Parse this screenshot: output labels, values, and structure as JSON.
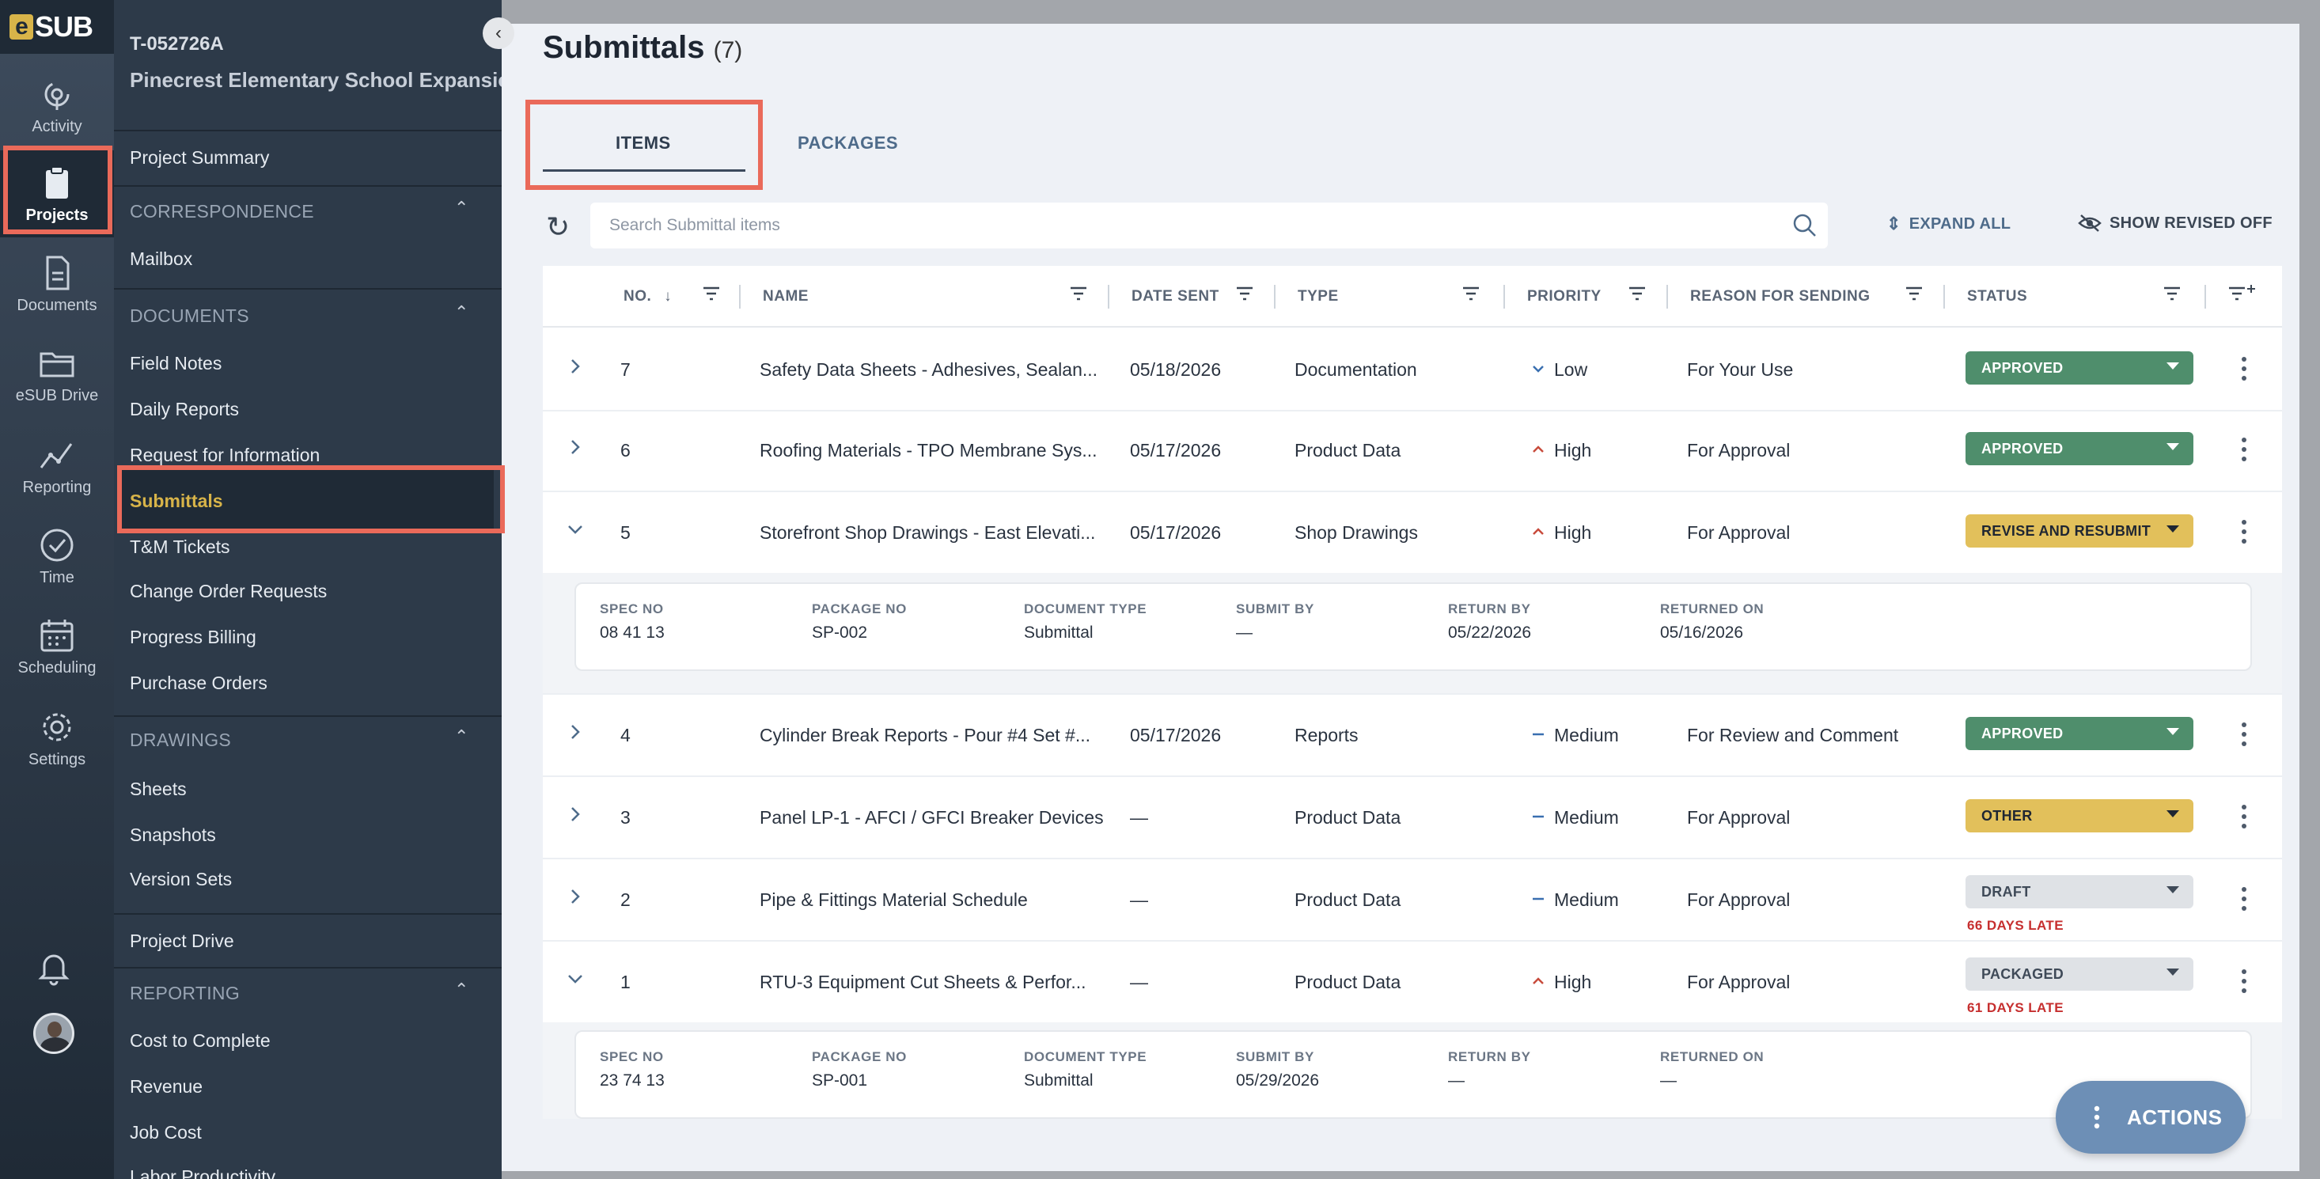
{
  "rail": {
    "logo": "SUB",
    "items": [
      {
        "label": "Activity",
        "icon": "activity-icon"
      },
      {
        "label": "Projects",
        "icon": "clipboard-icon"
      },
      {
        "label": "Documents",
        "icon": "document-icon"
      },
      {
        "label": "eSUB Drive",
        "icon": "folder-icon"
      },
      {
        "label": "Reporting",
        "icon": "chart-line-icon"
      },
      {
        "label": "Time",
        "icon": "clock-icon"
      },
      {
        "label": "Scheduling",
        "icon": "calendar-icon"
      },
      {
        "label": "Settings",
        "icon": "gear-icon"
      }
    ]
  },
  "nav": {
    "project_id": "T-052726A",
    "project_name": "Pinecrest Elementary School Expansion",
    "summary": "Project Summary",
    "correspondence": "CORRESPONDENCE",
    "mailbox": "Mailbox",
    "documents": "DOCUMENTS",
    "doc_items": [
      "Field Notes",
      "Daily Reports",
      "Request for Information",
      "Submittals",
      "T&M Tickets",
      "Change Order Requests",
      "Progress Billing",
      "Purchase Orders"
    ],
    "drawings": "DRAWINGS",
    "draw_items": [
      "Sheets",
      "Snapshots",
      "Version Sets"
    ],
    "project_drive": "Project Drive",
    "reporting": "REPORTING",
    "rep_items": [
      "Cost to Complete",
      "Revenue",
      "Job Cost",
      "Labor Productivity"
    ]
  },
  "main": {
    "title": "Submittals",
    "count": "(7)",
    "tabs": {
      "items": "ITEMS",
      "packages": "PACKAGES"
    },
    "search_placeholder": "Search Submittal items",
    "expand_all": "EXPAND ALL",
    "show_revised": "SHOW REVISED OFF",
    "actions": "ACTIONS"
  },
  "table": {
    "headers": {
      "no": "NO.",
      "name": "NAME",
      "date_sent": "DATE SENT",
      "type": "TYPE",
      "priority": "PRIORITY",
      "reason": "REASON FOR SENDING",
      "status": "STATUS"
    },
    "rows": [
      {
        "no": "7",
        "name": "Safety Data Sheets - Adhesives, Sealan...",
        "date": "05/18/2026",
        "type": "Documentation",
        "priority": "Low",
        "reason": "For Your Use",
        "status": "APPROVED"
      },
      {
        "no": "6",
        "name": "Roofing Materials - TPO Membrane Sys...",
        "date": "05/17/2026",
        "type": "Product Data",
        "priority": "High",
        "reason": "For Approval",
        "status": "APPROVED"
      },
      {
        "no": "5",
        "name": "Storefront Shop Drawings - East Elevati...",
        "date": "05/17/2026",
        "type": "Shop Drawings",
        "priority": "High",
        "reason": "For Approval",
        "status": "REVISE AND RESUBMIT"
      },
      {
        "no": "4",
        "name": "Cylinder Break Reports - Pour #4 Set #...",
        "date": "05/17/2026",
        "type": "Reports",
        "priority": "Medium",
        "reason": "For Review and Comment",
        "status": "APPROVED"
      },
      {
        "no": "3",
        "name": "Panel LP-1 - AFCI / GFCI Breaker Devices",
        "date": "—",
        "type": "Product Data",
        "priority": "Medium",
        "reason": "For Approval",
        "status": "OTHER"
      },
      {
        "no": "2",
        "name": "Pipe & Fittings Material Schedule",
        "date": "—",
        "type": "Product Data",
        "priority": "Medium",
        "reason": "For Approval",
        "status": "DRAFT",
        "late": "66 DAYS LATE"
      },
      {
        "no": "1",
        "name": "RTU-3 Equipment Cut Sheets & Perfor...",
        "date": "—",
        "type": "Product Data",
        "priority": "High",
        "reason": "For Approval",
        "status": "PACKAGED",
        "late": "61 DAYS LATE"
      }
    ],
    "detail_labels": {
      "spec": "SPEC NO",
      "package": "PACKAGE NO",
      "doctype": "DOCUMENT TYPE",
      "submit_by": "SUBMIT BY",
      "return_by": "RETURN BY",
      "returned_on": "RETURNED ON"
    },
    "detail5": {
      "spec": "08 41 13",
      "package": "SP-002",
      "doctype": "Submittal",
      "submit_by": "—",
      "return_by": "05/22/2026",
      "returned_on": "05/16/2026"
    },
    "detail1": {
      "spec": "23 74 13",
      "package": "SP-001",
      "doctype": "Submittal",
      "submit_by": "05/29/2026",
      "return_by": "—",
      "returned_on": "—"
    }
  },
  "colors": {
    "approved": "#4f8e6c",
    "revise": "#e2c05b",
    "late": "#c62f2f",
    "accent": "#d8b449",
    "highlight": "#ea6a5a"
  }
}
